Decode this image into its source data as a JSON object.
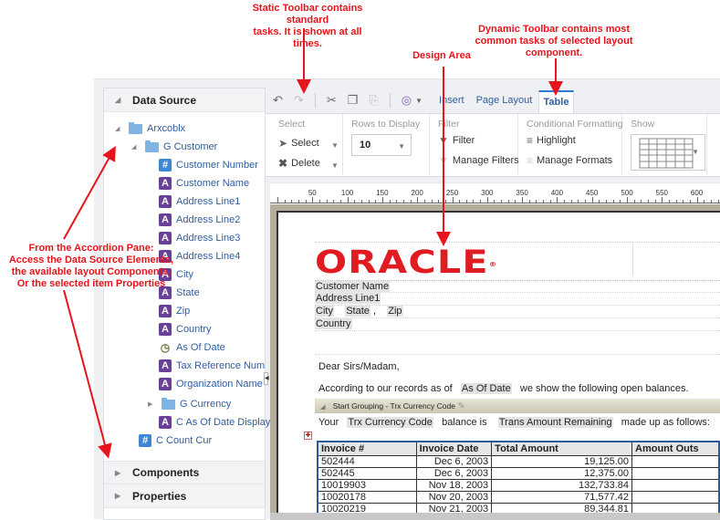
{
  "annotations": {
    "static_toolbar": [
      "Static Toolbar contains standard",
      "tasks. It is shown at all times."
    ],
    "dynamic_toolbar": [
      "Dynamic Toolbar contains most",
      "common tasks of selected layout",
      "component."
    ],
    "design_area": "Design Area",
    "accordion": [
      "From the Accordion Pane:",
      "Access the Data Source Elements,",
      "the available layout Components,",
      "Or the selected item Properties"
    ]
  },
  "accordion": {
    "data_source_label": "Data Source",
    "components_label": "Components",
    "properties_label": "Properties",
    "tree": [
      {
        "label": "Arxcoblx",
        "icon": "folder",
        "expanded": true,
        "level": 0
      },
      {
        "label": "G Customer",
        "icon": "folder",
        "expanded": true,
        "level": 1
      },
      {
        "label": "Customer Number",
        "icon": "number",
        "level": 2
      },
      {
        "label": "Customer Name",
        "icon": "text",
        "level": 2
      },
      {
        "label": "Address Line1",
        "icon": "text",
        "level": 2
      },
      {
        "label": "Address Line2",
        "icon": "text",
        "level": 2
      },
      {
        "label": "Address Line3",
        "icon": "text",
        "level": 2
      },
      {
        "label": "Address Line4",
        "icon": "text",
        "level": 2
      },
      {
        "label": "City",
        "icon": "text",
        "level": 2
      },
      {
        "label": "State",
        "icon": "text",
        "level": 2
      },
      {
        "label": "Zip",
        "icon": "text",
        "level": 2
      },
      {
        "label": "Country",
        "icon": "text",
        "level": 2
      },
      {
        "label": "As Of Date",
        "icon": "date",
        "level": 2
      },
      {
        "label": "Tax Reference Num",
        "icon": "text",
        "level": 2
      },
      {
        "label": "Organization Name",
        "icon": "text",
        "level": 2
      },
      {
        "label": "G Currency",
        "icon": "folder",
        "expanded": false,
        "level": 2
      },
      {
        "label": "C As Of Date Display",
        "icon": "text",
        "level": 2
      },
      {
        "label": "C Count Cur",
        "icon": "number",
        "level": 1
      }
    ]
  },
  "toolbar": {
    "tabs": [
      "Insert",
      "Page Layout"
    ],
    "active_tab": "Table",
    "groups": {
      "select": {
        "title": "Select",
        "select_label": "Select",
        "delete_label": "Delete"
      },
      "rows": {
        "title": "Rows to Display",
        "value": "10"
      },
      "filter": {
        "title": "Filter",
        "filter_label": "Filter",
        "manage_label": "Manage Filters"
      },
      "conditional": {
        "title": "Conditional Formatting",
        "highlight_label": "Highlight",
        "manage_label": "Manage Formats"
      },
      "show": {
        "title": "Show"
      }
    }
  },
  "ruler": {
    "labels": [
      "50",
      "100",
      "150",
      "200",
      "250",
      "300",
      "350",
      "400",
      "450",
      "500",
      "550",
      "600"
    ]
  },
  "design": {
    "logo": "ORACLE",
    "fields": {
      "customer_name": "Customer Name",
      "address_line1": "Address Line1",
      "city": "City",
      "state": "State",
      "comma": ",",
      "zip": "Zip",
      "country": "Country"
    },
    "greeting": "Dear Sirs/Madam,",
    "records_prefix": "According to our records as of",
    "as_of_date": "As Of Date",
    "records_suffix": "we show the following open balances.",
    "grouping_label": "Start Grouping - Trx Currency Code",
    "your": "Your",
    "trx_currency_code": "Trx Currency Code",
    "balance_is": "balance is",
    "trans_amount_remaining": "Trans Amount Remaining",
    "made_up": "made up as follows:",
    "table": {
      "headers": [
        "Invoice #",
        "Invoice Date",
        "Total Amount",
        "Amount Outs"
      ],
      "rows": [
        [
          "502444",
          "Dec 6, 2003",
          "19,125.00",
          ""
        ],
        [
          "502445",
          "Dec 6, 2003",
          "12,375.00",
          ""
        ],
        [
          "10019903",
          "Nov 18, 2003",
          "132,733.84",
          ""
        ],
        [
          "10020178",
          "Nov 20, 2003",
          "71,577.42",
          ""
        ],
        [
          "10020219",
          "Nov 21, 2003",
          "89,344.81",
          ""
        ]
      ]
    }
  }
}
